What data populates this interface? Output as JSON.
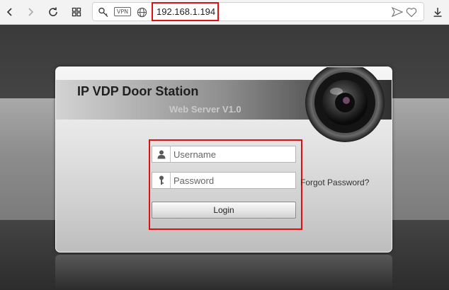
{
  "browser": {
    "url": "192.168.1.194",
    "vpn_label": "VPN",
    "icons": [
      "back-icon",
      "forward-icon",
      "reload-icon",
      "tabs-grid-icon",
      "key-icon",
      "vpn-badge",
      "globe-icon",
      "send-icon",
      "heart-icon",
      "download-icon"
    ]
  },
  "panel": {
    "title": "IP VDP Door Station",
    "subtitle": "Web Server V1.0",
    "username_placeholder": "Username",
    "password_placeholder": "Password",
    "forgot_label": "Forgot Password?",
    "login_label": "Login"
  },
  "colors": {
    "highlight": "#e01010",
    "page_bg": "#3b3b3b"
  }
}
